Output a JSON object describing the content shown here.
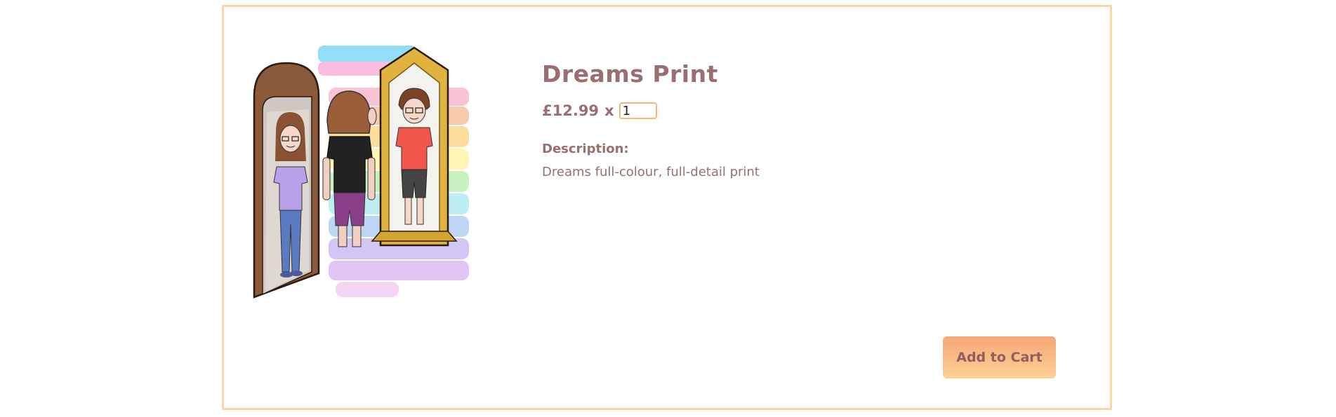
{
  "product": {
    "title": "Dreams Print",
    "price": "£12.99",
    "multiplier": "x",
    "quantity": "1",
    "description_label": "Description:",
    "description": "Dreams full-colour, full-detail print",
    "image_alt": "Illustration of a person looking into two mirrors with rainbow stripes behind"
  },
  "actions": {
    "add_to_cart": "Add to Cart"
  },
  "colors": {
    "border": "#fcd6a8",
    "text": "#9a6f6f",
    "button_top": "#f6a878",
    "button_bottom": "#fcd093",
    "input_border": "#f3b877"
  }
}
